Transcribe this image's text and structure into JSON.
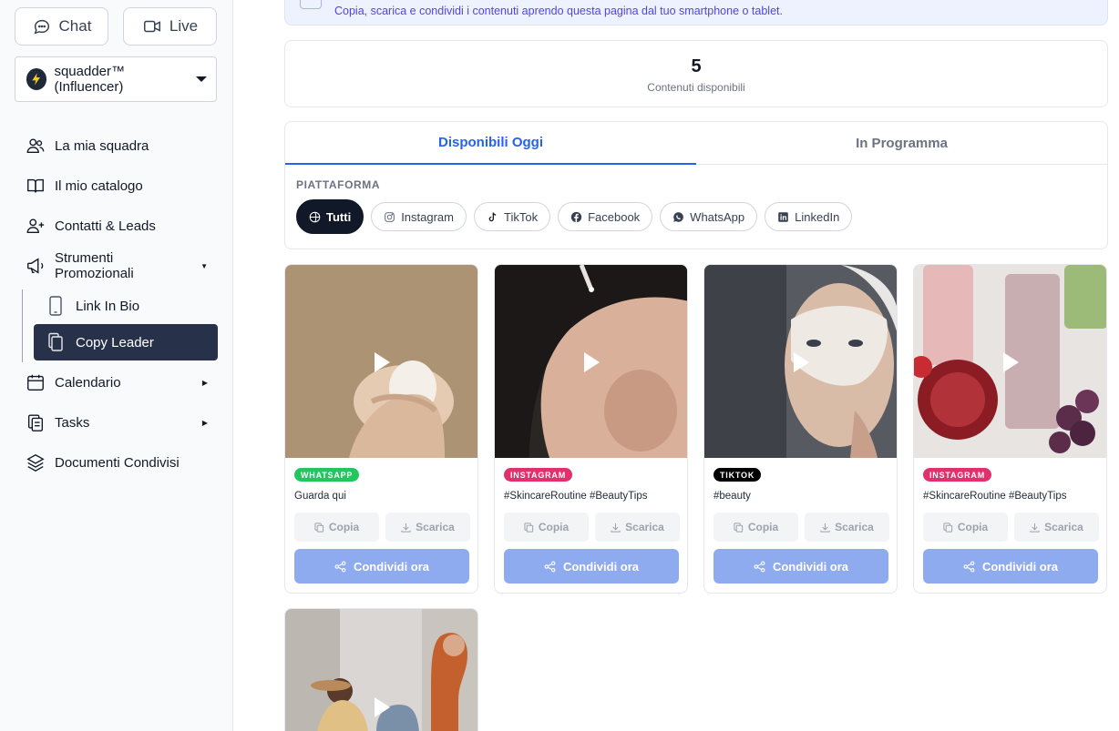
{
  "sidebar": {
    "chat_label": "Chat",
    "live_label": "Live",
    "account_name": "squadder™ (Influencer)",
    "nav": [
      {
        "label": "La mia squadra"
      },
      {
        "label": "Il mio catalogo"
      },
      {
        "label": "Contatti & Leads"
      },
      {
        "label": "Strumenti Promozionali"
      },
      {
        "label": "Link In Bio"
      },
      {
        "label": "Copy Leader"
      },
      {
        "label": "Calendario"
      },
      {
        "label": "Tasks"
      },
      {
        "label": "Documenti Condivisi"
      }
    ]
  },
  "main": {
    "banner_text": "Copia, scarica e condividi i contenuti aprendo questa pagina dal tuo smartphone o tablet.",
    "stat_value": "5",
    "stat_label": "Contenuti disponibili",
    "tabs": [
      "Disponibili Oggi",
      "In Programma"
    ],
    "platform_label": "PIATTAFORMA",
    "filters": [
      "Tutti",
      "Instagram",
      "TikTok",
      "Facebook",
      "WhatsApp",
      "LinkedIn"
    ],
    "cards": [
      {
        "badge": "WHATSAPP",
        "badge_color": "#22c55e",
        "caption": "Guarda qui"
      },
      {
        "badge": "INSTAGRAM",
        "badge_color": "#e1306c",
        "caption": "#SkincareRoutine #BeautyTips"
      },
      {
        "badge": "TIKTOK",
        "badge_color": "#000000",
        "caption": "#beauty"
      },
      {
        "badge": "INSTAGRAM",
        "badge_color": "#e1306c",
        "caption": "#SkincareRoutine #BeautyTips"
      }
    ],
    "copy_label": "Copia",
    "download_label": "Scarica",
    "share_label": "Condividi ora"
  },
  "colors": {
    "accent": "#2563eb",
    "sidebar_active": "#27324a",
    "share_button": "#8fabef"
  }
}
